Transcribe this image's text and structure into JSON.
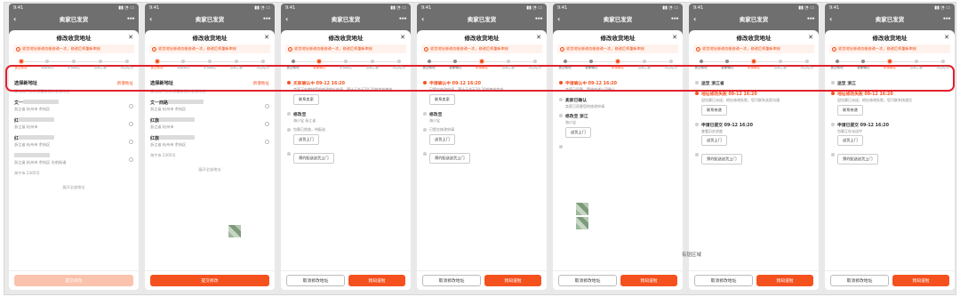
{
  "status_time": "9:41",
  "header": {
    "title": "卖家已发货"
  },
  "sheet_title": "修改收货地址",
  "notice": "收货地址修改仅能修改一次，修改后将重新审核",
  "steps": [
    "提交修改",
    "卖家确认",
    "申请确认",
    "包裹拦截",
    "派送成功"
  ],
  "screens": [
    {
      "active_step": 0,
      "select_title": "选择新地址",
      "new_address": "新增地址",
      "tip": "请勾选下方你想要修改的收货地址",
      "addresses": [
        {
          "name": "文一",
          "detail": "浙江省 杭州市 余杭区"
        },
        {
          "name": "红",
          "detail": "浙江省 杭州市"
        },
        {
          "name": "红",
          "detail": "浙江省 杭州市 余杭区"
        },
        {
          "name": "",
          "detail": "浙江省 杭州市 余杭区 仓前街道"
        }
      ],
      "extra": "海宁市 2305号",
      "expand": "展开全部地址",
      "submit": "提交修改"
    },
    {
      "active_step": 0,
      "select_title": "选择新地址",
      "new_address": "新增地址",
      "tip": "请勾选下方你想要修改的收货地址",
      "addresses": [
        {
          "name": "文一西路",
          "detail": "浙江省 杭州市 余杭区"
        },
        {
          "name": "红旗",
          "detail": "浙江省 杭州市"
        },
        {
          "name": "红旗",
          "detail": "浙江省 杭州市 余杭区"
        }
      ],
      "extra": "海宁市 2305号",
      "expand": "展开全部地址",
      "submit": "提交修改"
    },
    {
      "active_step": 1,
      "events": [
        {
          "title": "买家确认中 09-12 16:20",
          "desc": "卖家正在审核您的修改地址申请，预计于今天20:20前完成审核",
          "active": true,
          "btn": "联系卖家"
        },
        {
          "title": "修改至",
          "desc": "海小宝 浙江省",
          "active": false,
          "btn": ""
        },
        {
          "title": "",
          "desc": "包裹已揽收，待配送",
          "active": false,
          "btn": "送货上门"
        },
        {
          "title": "",
          "desc": "",
          "active": false,
          "btn": "预约配送送货上门"
        }
      ],
      "cancel": "取消修改地址",
      "confirm": "我知道啦"
    },
    {
      "active_step": 2,
      "events": [
        {
          "title": "申请确认中 09-12 16:20",
          "desc": "已提交修改申请，预计于今天20:20前审核完成",
          "active": true,
          "btn": "联系卖家"
        },
        {
          "title": "修改至",
          "desc": "海小宝",
          "active": false,
          "btn": ""
        },
        {
          "title": "",
          "desc": "已提交修改申请",
          "active": false,
          "btn": "送货上门"
        },
        {
          "title": "",
          "desc": "",
          "active": false,
          "btn": "预约配送送货上门"
        }
      ],
      "cancel": "取消修改地址",
      "confirm": "我知道啦"
    },
    {
      "active_step": 2,
      "events": [
        {
          "title": "申请确认中 09-12 16:20",
          "desc": "卖家已同意，等待快递公司确认",
          "active": true,
          "btn": ""
        },
        {
          "title": "卖家已确认",
          "desc": "卖家已同意您的修改申请",
          "active": false,
          "btn": ""
        },
        {
          "title": "修改至 浙江",
          "desc": "海小宝",
          "active": false,
          "btn": "送货上门"
        },
        {
          "title": "",
          "desc": "",
          "active": false,
          "btn": ""
        }
      ],
      "cancel": "取消修改地址",
      "confirm": "我知道啦"
    },
    {
      "active_step": 2,
      "events": [
        {
          "title": "送至 浙江省",
          "desc": "",
          "active": false,
          "btn": ""
        },
        {
          "title": "地址修改失败 09-12 16:20",
          "desc": "因包裹已派送，地址修改失败，您可联系卖家沟通",
          "active": true,
          "btn": "联系快递"
        },
        {
          "title": "申请已提交 09-12 16:20",
          "desc": "查看历史进度",
          "active": false,
          "btn": "送货上门"
        },
        {
          "title": "",
          "desc": "",
          "active": false,
          "btn": "预约配送送货上门"
        }
      ],
      "cancel": "取消修改地址",
      "confirm": "我知道啦"
    },
    {
      "active_step": 2,
      "events": [
        {
          "title": "送至 浙江",
          "desc": "",
          "active": false,
          "btn": ""
        },
        {
          "title": "地址修改失败 09-12 16:20",
          "desc": "因包裹已派送，地址修改失败，您可联系快递员",
          "active": true,
          "btn": "联系快递"
        },
        {
          "title": "申请已提交 09-12 16:20",
          "desc": "包裹正在派送中",
          "active": false,
          "btn": "送货上门"
        },
        {
          "title": "",
          "desc": "",
          "active": false,
          "btn": "预约配送送货上门"
        }
      ],
      "cancel": "取消修改地址",
      "confirm": "我知道啦"
    }
  ],
  "caption": "有钮区域"
}
